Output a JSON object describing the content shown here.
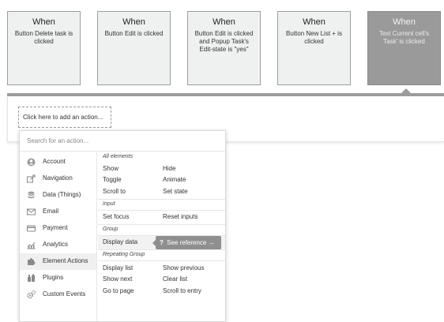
{
  "events": [
    {
      "when": "When",
      "description": "Button Delete task is clicked",
      "selected": false
    },
    {
      "when": "When",
      "description": "Button Edit is clicked",
      "selected": false
    },
    {
      "when": "When",
      "description": "Button Edit is clicked and Popup Task's Edit-state is \"yes\"",
      "selected": false
    },
    {
      "when": "When",
      "description": "Button New List + is clicked",
      "selected": false
    },
    {
      "when": "When",
      "description": "Text Current cell's Task' is clicked",
      "selected": true
    }
  ],
  "workflow": {
    "add_action_label": "Click here to add an action..."
  },
  "menu": {
    "search_placeholder": "Search for an action...",
    "categories": [
      {
        "label": "Account",
        "icon": "account-icon"
      },
      {
        "label": "Navigation",
        "icon": "navigation-icon"
      },
      {
        "label": "Data (Things)",
        "icon": "database-icon"
      },
      {
        "label": "Email",
        "icon": "email-icon"
      },
      {
        "label": "Payment",
        "icon": "payment-icon"
      },
      {
        "label": "Analytics",
        "icon": "analytics-icon"
      },
      {
        "label": "Element Actions",
        "icon": "puzzle-icon",
        "active": true
      },
      {
        "label": "Plugins",
        "icon": "plugins-icon"
      },
      {
        "label": "Custom Events",
        "icon": "gears-icon"
      }
    ],
    "sections": [
      {
        "title": "All elements",
        "actions": [
          "Show",
          "Hide",
          "Toggle",
          "Animate",
          "Scroll to",
          "Set state"
        ]
      },
      {
        "title": "Input",
        "actions": [
          "Set focus",
          "Reset inputs"
        ]
      },
      {
        "title": "Group",
        "actions": [
          "Display data"
        ]
      },
      {
        "title": "Repeating Group",
        "actions": [
          "Display list",
          "Show previous",
          "Show next",
          "Clear list",
          "Go to page",
          "Scroll to entry"
        ]
      }
    ],
    "tooltip": {
      "icon": "?",
      "label": "See reference →"
    }
  },
  "colors": {
    "selected_card": "#9a9a9a",
    "card_bg": "#eef1f0",
    "tooltip_bg": "#8f8f8f"
  }
}
